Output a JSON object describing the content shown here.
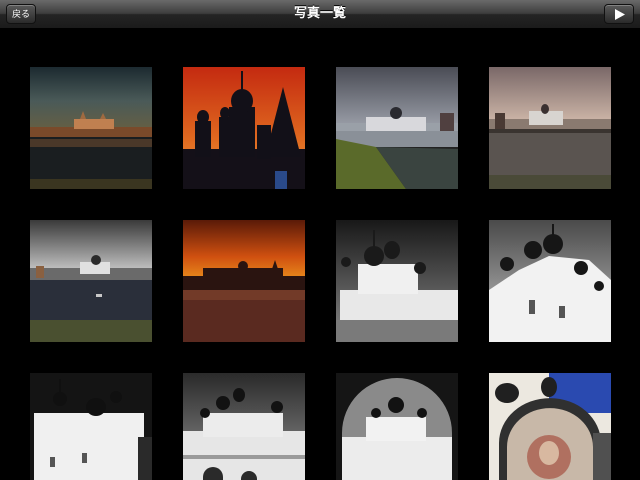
{
  "navbar": {
    "back_label": "戻る",
    "title": "写真一覧",
    "play_icon": "play-icon"
  },
  "colors": {
    "navbar_top": "#6a6a6a",
    "navbar_bottom": "#1b1b1b",
    "background": "#000000"
  },
  "photos": [
    {
      "id": "p1",
      "scene": "lake-fortress-dusk"
    },
    {
      "id": "p2",
      "scene": "red-sky-church-silhouette"
    },
    {
      "id": "p3",
      "scene": "grey-sky-fortress-grass"
    },
    {
      "id": "p4",
      "scene": "pink-sky-fortress-sea"
    },
    {
      "id": "p5",
      "scene": "bw-fortress-sea"
    },
    {
      "id": "p6",
      "scene": "orange-sunset-fortress"
    },
    {
      "id": "p7",
      "scene": "bw-white-church-domes"
    },
    {
      "id": "p8",
      "scene": "bw-church-closeup"
    },
    {
      "id": "p9",
      "scene": "bw-white-church-dark"
    },
    {
      "id": "p10",
      "scene": "bw-monastery-front"
    },
    {
      "id": "p11",
      "scene": "bw-church-through-arch"
    },
    {
      "id": "p12",
      "scene": "blue-sky-fresco-arch"
    }
  ]
}
